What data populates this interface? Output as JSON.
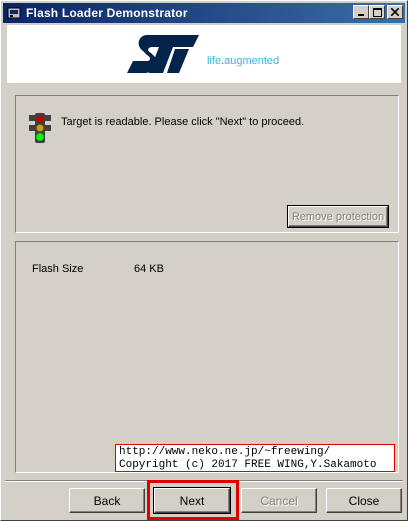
{
  "window": {
    "title": "Flash Loader Demonstrator"
  },
  "banner": {
    "tagline_main": "life",
    "tagline_dot": ".",
    "tagline_rest": "augmented"
  },
  "status": {
    "message": "Target is readable. Please click \"Next\" to proceed."
  },
  "remove_protection_label": "Remove protection",
  "flash": {
    "label": "Flash Size",
    "value": "64 KB"
  },
  "watermark": {
    "line1": "http://www.neko.ne.jp/~freewing/",
    "line2": "Copyright (c) 2017 FREE WING,Y.Sakamoto"
  },
  "nav": {
    "back": "Back",
    "next": "Next",
    "cancel": "Cancel",
    "close": "Close"
  },
  "colors": {
    "title_start": "#0a246a",
    "title_end": "#3a6ea5",
    "st_blue": "#03234b",
    "st_light_blue": "#3cb4e6",
    "highlight_red": "#e00000"
  }
}
